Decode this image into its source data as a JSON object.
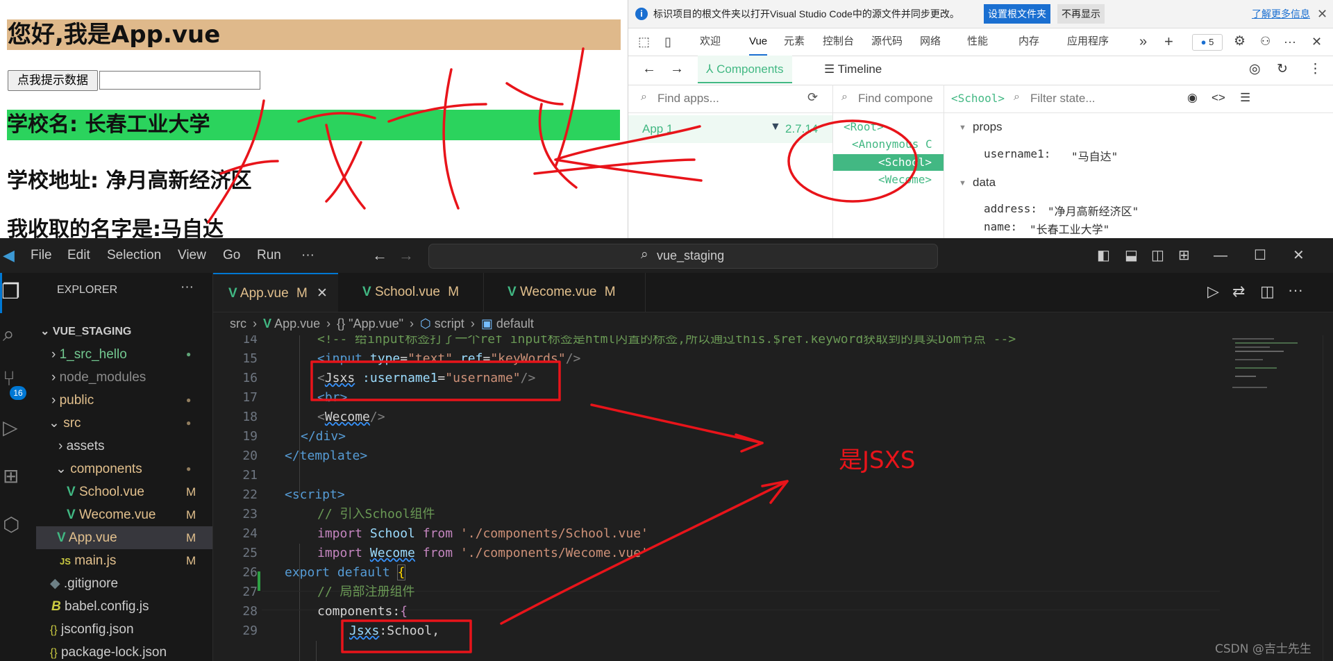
{
  "browser_page": {
    "greeting": "您好,我是App.vue",
    "prompt_button": "点我提示数据",
    "school_name_line": "学校名: 长春工业大学",
    "school_address_line": "学校地址: 净月高新经济区",
    "received_name_line": "我收取的名字是:马自达"
  },
  "devtools": {
    "info_text": "标识项目的根文件夹以打开Visual Studio Code中的源文件并同步更改。",
    "set_root_button": "设置根文件夹",
    "dismiss_button": "不再显示",
    "learn_more": "了解更多信息",
    "tabs": [
      "欢迎",
      "Vue",
      "元素",
      "控制台",
      "源代码",
      "网络",
      "性能",
      "内存",
      "应用程序"
    ],
    "issues_count": "5",
    "vue_tabs": {
      "components": "Components",
      "timeline": "Timeline"
    },
    "find_apps_placeholder": "Find apps...",
    "find_components_placeholder": "Find compone",
    "selected_component": "<School>",
    "filter_state_placeholder": "Filter state...",
    "app_name": "App 1",
    "vue_version": "2.7.14",
    "tree": [
      "<Root>",
      "<Anonymous C",
      "<School>",
      "<Wecome>"
    ],
    "props_label": "props",
    "props": [
      {
        "key": "username1:",
        "value": "\"马自达\""
      }
    ],
    "data_label": "data",
    "data": [
      {
        "key": "address:",
        "value": "\"净月高新经济区\""
      },
      {
        "key": "name:",
        "value": "\"长春工业大学\""
      }
    ]
  },
  "vscode": {
    "menu": [
      "File",
      "Edit",
      "Selection",
      "View",
      "Go",
      "Run",
      "···"
    ],
    "search_text": "vue_staging",
    "explorer_title": "EXPLORER",
    "source_control_badge": "16",
    "root_folder": "VUE_STAGING",
    "tree": [
      {
        "label": "1_src_hello",
        "color": "#73c991",
        "status": "●"
      },
      {
        "label": "node_modules",
        "color": "#8b8b8b",
        "status": ""
      },
      {
        "label": "public",
        "color": "#e2c08d",
        "status": "●"
      },
      {
        "label": "src",
        "color": "#e2c08d",
        "status": "●"
      },
      {
        "label": "assets",
        "color": "#cccccc",
        "status": ""
      },
      {
        "label": "components",
        "color": "#e2c08d",
        "status": "●"
      },
      {
        "label": "School.vue",
        "color": "#e2c08d",
        "status": "M"
      },
      {
        "label": "Wecome.vue",
        "color": "#e2c08d",
        "status": "M"
      },
      {
        "label": "App.vue",
        "color": "#e2c08d",
        "status": "M"
      },
      {
        "label": "main.js",
        "color": "#e2c08d",
        "status": "M"
      },
      {
        "label": ".gitignore",
        "color": "#cccccc",
        "status": ""
      },
      {
        "label": "babel.config.js",
        "color": "#cccccc",
        "status": ""
      },
      {
        "label": "jsconfig.json",
        "color": "#cccccc",
        "status": ""
      },
      {
        "label": "package-lock.json",
        "color": "#cccccc",
        "status": ""
      }
    ],
    "tabs": [
      {
        "label": "App.vue",
        "status": "M"
      },
      {
        "label": "School.vue",
        "status": "M"
      },
      {
        "label": "Wecome.vue",
        "status": "M"
      }
    ],
    "breadcrumb": [
      "src",
      "App.vue",
      "{} \"App.vue\"",
      "script",
      "default"
    ],
    "line_numbers": [
      "14",
      "15",
      "16",
      "17",
      "18",
      "19",
      "20",
      "21",
      "22",
      "23",
      "24",
      "25",
      "26",
      "27",
      "28",
      "29"
    ],
    "code": {
      "l14": "<!-- 给input标签打了一个ref input标签是html内置的标签,所以通过this.$ref.keyword获取到的真实Dom节点 -->",
      "l15_tag": "<input",
      "l15_attr1": "type",
      "l15_val1": "\"text\"",
      "l15_attr2": "ref",
      "l15_val2": "\"keyWords\"",
      "l15_end": "/>",
      "l16_open": "<",
      "l16_tag": "Jsxs",
      "l16_attr": ":username1",
      "l16_val": "\"username\"",
      "l16_end": "/>",
      "l17": "<br>",
      "l18_open": "<",
      "l18_tag": "Wecome",
      "l18_end": "/>",
      "l19": "</div>",
      "l20": "</template>",
      "l22": "<script>",
      "l23": "// 引入School组件",
      "l24_kw": "import",
      "l24_name": "School",
      "l24_from": "from",
      "l24_path": "'./components/School.vue'",
      "l25_kw": "import",
      "l25_name": "Wecome",
      "l25_from": "from",
      "l25_path": "'./components/Wecome.vue'",
      "l26_kw1": "export",
      "l26_kw2": "default",
      "l26_brace": "{",
      "l27": "// 局部注册组件",
      "l28_key": "components:",
      "l28_brace": "{",
      "l29_key": "Jsxs",
      "l29_val": ":School,"
    }
  },
  "annotation": {
    "note": "是JSXS"
  },
  "watermark": "CSDN @吉士先生"
}
